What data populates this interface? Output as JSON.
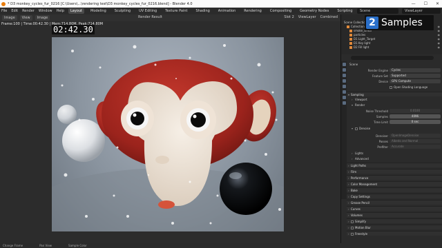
{
  "window": {
    "title": "* D3 monkey_cycles_fur_0216 [C:\\Users\\...\\rendering test\\D3 monkey_cycles_fur_0216.blend] - Blender 4.0",
    "buttons": [
      "—",
      "☐",
      "✕"
    ]
  },
  "menu": {
    "items": [
      "File",
      "Edit",
      "Render",
      "Window",
      "Help"
    ],
    "workspaces": [
      "Layout",
      "Modeling",
      "Sculpting",
      "UV Editing",
      "Texture Paint",
      "Shading",
      "Animation",
      "Rendering",
      "Compositing",
      "Geometry Nodes",
      "Scripting"
    ],
    "active_workspace": "Layout",
    "scene": "Scene",
    "view_layer": "ViewLayer"
  },
  "viewport": {
    "header": {
      "editor": "Image",
      "view": "View",
      "image": "Image",
      "render_result": "Render Result",
      "slot": "Slot 2",
      "view_layer": "ViewLayer",
      "pass": "Combined"
    },
    "frame_info": "Frame:100 | Time:00:42.30 | Mem:714.80M, Peak:714.80M",
    "timecode": "02:42.30"
  },
  "badge": {
    "number": "2",
    "label": "Samples"
  },
  "outliner": {
    "rows": [
      {
        "label": "Scene Collection",
        "indent": 0
      },
      {
        "label": "Collection",
        "indent": 1
      },
      {
        "label": "smoke_simul",
        "indent": 2
      },
      {
        "label": "particles",
        "indent": 2
      },
      {
        "label": "D1 Light_Target",
        "indent": 2
      },
      {
        "label": "D1 Key light",
        "indent": 2
      },
      {
        "label": "D2 Fill light",
        "indent": 2
      }
    ]
  },
  "properties": {
    "search_placeholder": "",
    "crumb": "Scene",
    "render_engine": {
      "label": "Render Engine",
      "value": "Cycles"
    },
    "feature_set": {
      "label": "Feature Set",
      "value": "Supported"
    },
    "device": {
      "label": "Device",
      "value": "GPU Compute"
    },
    "osl": {
      "label": "Open Shading Language",
      "checked": false
    },
    "sampling": "Sampling",
    "viewport_sub": "Viewport",
    "render_sub": "Render",
    "noise_threshold": {
      "label": "Noise Threshold",
      "value": "0.0100"
    },
    "samples": {
      "label": "Samples",
      "value": "4096"
    },
    "time_limit": {
      "label": "Time Limit",
      "value": "0 sec"
    },
    "denoise": {
      "label": "Denoise",
      "checked": false
    },
    "denoiser": {
      "label": "Denoiser",
      "value": "OpenImageDenoise"
    },
    "passes": {
      "label": "Passes",
      "value": "Albedo and Normal"
    },
    "prefilter": {
      "label": "Prefilter",
      "value": "Accurate"
    },
    "lights_sub": "Lights",
    "advanced_sub": "Advanced",
    "sections": [
      "Light Paths",
      "Film",
      "Performance",
      "Color Management",
      "Bake",
      "Copy Settings",
      "Grease Pencil",
      "Curves",
      "Volumes",
      "Simplify",
      "Motion Blur",
      "Freestyle"
    ],
    "checkbox_sections": [
      "Simplify",
      "Motion Blur",
      "Freestyle"
    ]
  },
  "status": {
    "items": [
      "Change Frame",
      "Pan View",
      "Sample Color"
    ]
  },
  "colors": {
    "accent_blue": "#2a6fc9",
    "fur_red": "#a3261f",
    "face_cream": "#ebe0d3"
  }
}
